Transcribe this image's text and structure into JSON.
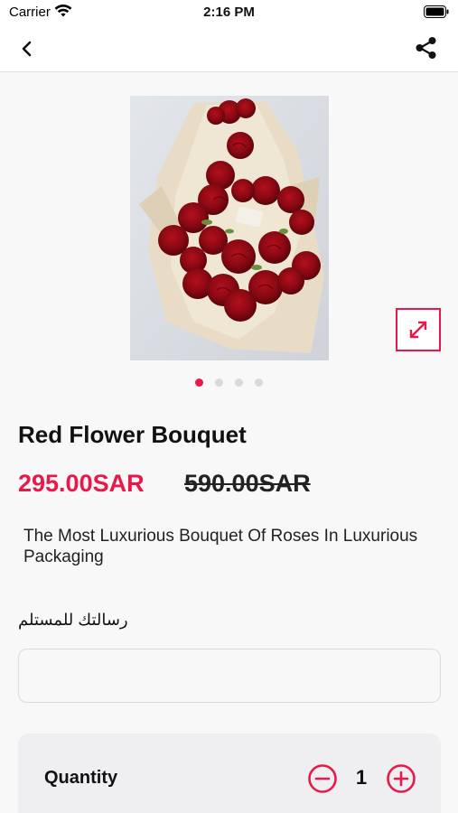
{
  "status_bar": {
    "carrier": "Carrier",
    "time": "2:16 PM"
  },
  "nav": {
    "back_icon": "chevron-left-icon",
    "share_icon": "share-icon"
  },
  "gallery": {
    "expand_icon": "expand-arrows-icon",
    "image_count": 4,
    "active_index": 0
  },
  "product": {
    "title": "Red Flower Bouquet",
    "price": "295.00SAR",
    "old_price": "590.00SAR",
    "description": "The Most Luxurious Bouquet Of Roses In Luxurious Packaging"
  },
  "message": {
    "label": "رسالتك للمستلم",
    "value": "",
    "placeholder": ""
  },
  "quantity": {
    "label": "Quantity",
    "value": "1",
    "minus_icon": "minus-circle-icon",
    "plus_icon": "plus-circle-icon"
  },
  "colors": {
    "accent": "#e8194a",
    "background": "#f8f8f8",
    "card": "#efeff1"
  }
}
